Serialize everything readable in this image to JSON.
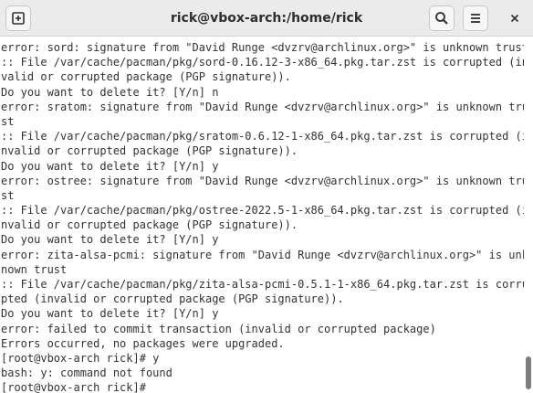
{
  "window": {
    "title": "rick@vbox-arch:/home/rick",
    "icons": {
      "new_tab": "new-tab-icon",
      "search": "search-icon",
      "menu": "hamburger-menu-icon",
      "close": "close-icon"
    }
  },
  "terminal": {
    "lines": [
      "error: sord: signature from \"David Runge <dvzrv@archlinux.org>\" is unknown trust",
      ":: File /var/cache/pacman/pkg/sord-0.16.12-3-x86_64.pkg.tar.zst is corrupted (in",
      "valid or corrupted package (PGP signature)).",
      "Do you want to delete it? [Y/n] n",
      "error: sratom: signature from \"David Runge <dvzrv@archlinux.org>\" is unknown tru",
      "st",
      ":: File /var/cache/pacman/pkg/sratom-0.6.12-1-x86_64.pkg.tar.zst is corrupted (i",
      "nvalid or corrupted package (PGP signature)).",
      "Do you want to delete it? [Y/n] y",
      "error: ostree: signature from \"David Runge <dvzrv@archlinux.org>\" is unknown tru",
      "st",
      ":: File /var/cache/pacman/pkg/ostree-2022.5-1-x86_64.pkg.tar.zst is corrupted (i",
      "nvalid or corrupted package (PGP signature)).",
      "Do you want to delete it? [Y/n] y",
      "error: zita-alsa-pcmi: signature from \"David Runge <dvzrv@archlinux.org>\" is unk",
      "nown trust",
      ":: File /var/cache/pacman/pkg/zita-alsa-pcmi-0.5.1-1-x86_64.pkg.tar.zst is corru",
      "pted (invalid or corrupted package (PGP signature)).",
      "Do you want to delete it? [Y/n] y",
      "error: failed to commit transaction (invalid or corrupted package)",
      "Errors occurred, no packages were upgraded.",
      "[root@vbox-arch rick]# y",
      "bash: y: command not found",
      "[root@vbox-arch rick]#"
    ],
    "colors": {
      "text": "#2e3436",
      "background": "#ffffff",
      "titlebar": "#ebebeb"
    }
  }
}
